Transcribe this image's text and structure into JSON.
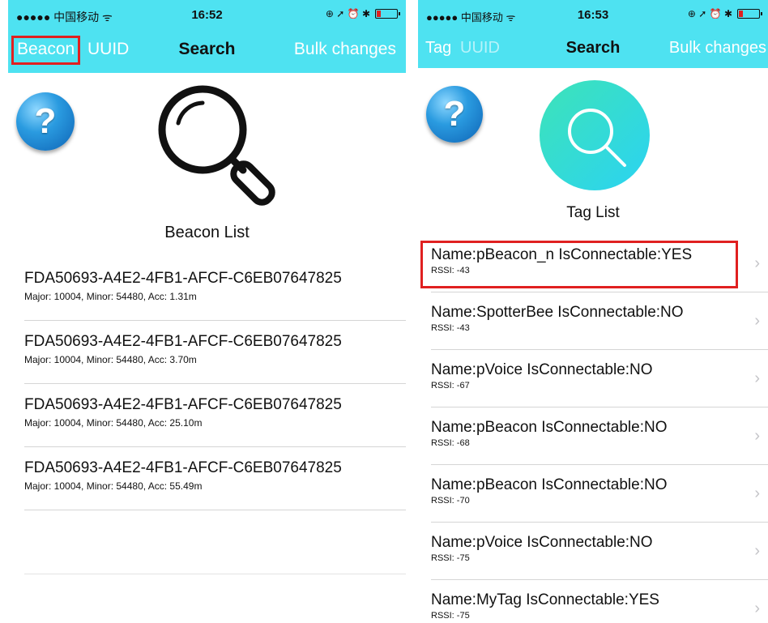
{
  "left": {
    "status": {
      "carrier": "●●●●● 中国移动 ᯤ",
      "time": "16:52",
      "right": "⊕ ➚ ⏰ ✱"
    },
    "nav": {
      "left_selected": "Beacon",
      "left_other": "UUID",
      "title": "Search",
      "right": "Bulk changes"
    },
    "help_icon": "?",
    "list_title": "Beacon List",
    "rows": [
      {
        "uuid": "FDA50693-A4E2-4FB1-AFCF-C6EB07647825",
        "sub": "Major: 10004, Minor: 54480, Acc: 1.31m"
      },
      {
        "uuid": "FDA50693-A4E2-4FB1-AFCF-C6EB07647825",
        "sub": "Major: 10004, Minor: 54480, Acc: 3.70m"
      },
      {
        "uuid": "FDA50693-A4E2-4FB1-AFCF-C6EB07647825",
        "sub": "Major: 10004, Minor: 54480, Acc: 25.10m"
      },
      {
        "uuid": "FDA50693-A4E2-4FB1-AFCF-C6EB07647825",
        "sub": "Major: 10004, Minor: 54480, Acc: 55.49m"
      }
    ]
  },
  "right": {
    "status": {
      "carrier": "●●●●● 中国移动 ᯤ",
      "time": "16:53",
      "right": "⊕ ➚ ⏰ ✱"
    },
    "nav": {
      "left_selected": "Tag",
      "left_other": "UUID",
      "title": "Search",
      "right": "Bulk changes"
    },
    "help_icon": "?",
    "list_title": "Tag List",
    "rows": [
      {
        "name": "Name:pBeacon_n  IsConnectable:YES",
        "rssi": "RSSI: -43"
      },
      {
        "name": "Name:SpotterBee  IsConnectable:NO",
        "rssi": "RSSI: -43"
      },
      {
        "name": "Name:pVoice  IsConnectable:NO",
        "rssi": "RSSI: -67"
      },
      {
        "name": "Name:pBeacon  IsConnectable:NO",
        "rssi": "RSSI: -68"
      },
      {
        "name": "Name:pBeacon  IsConnectable:NO",
        "rssi": "RSSI: -70"
      },
      {
        "name": "Name:pVoice  IsConnectable:NO",
        "rssi": "RSSI: -75"
      },
      {
        "name": "Name:MyTag  IsConnectable:YES",
        "rssi": "RSSI: -75"
      }
    ],
    "chevron": "›"
  },
  "colors": {
    "accent": "#4ee2f1",
    "highlight": "#e02020",
    "search_circle_start": "#3de3b8",
    "search_circle_end": "#2bd3f2"
  }
}
